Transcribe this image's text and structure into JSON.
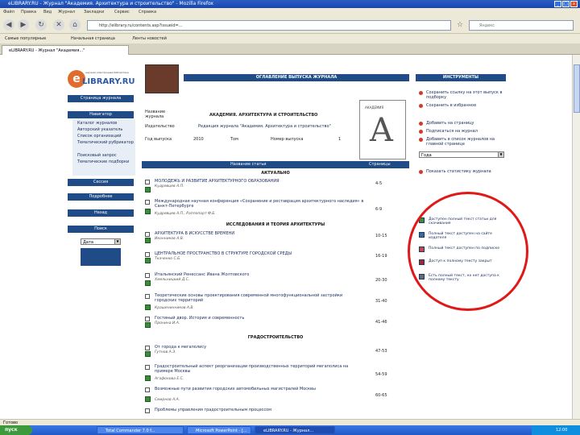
{
  "window": {
    "title": "eLIBRARY.RU - Журнал \"Академия. Архитектура и строительство\" - Mozilla Firefox",
    "controls": [
      "_",
      "□",
      "x"
    ]
  },
  "menu": [
    "Файл",
    "Правка",
    "Вид",
    "Журнал",
    "Закладки",
    "Сервис",
    "Справка"
  ],
  "nav": {
    "url": "http://elibrary.ru/contents.asp?issueid=...",
    "search_placeholder": "Яндекс"
  },
  "bookmarks": [
    "Самые популярные",
    "Начальная страница",
    "Ленты новостей"
  ],
  "tab": {
    "label": "eLIBRARY.RU - Журнал \"Академия...\""
  },
  "logo": {
    "letter": "e",
    "text": "LIBRARY.RU",
    "sub": "научная электронная библиотека"
  },
  "page_title": "ОГЛАВЛЕНИЕ ВЫПУСКА ЖУРНАЛА",
  "journal": {
    "name_label": "Название журнала",
    "name_value": "АКАДЕМИЯ. АРХИТЕКТУРА И СТРОИТЕЛЬСТВО",
    "publisher_label": "Издательство",
    "publisher_value": "Редакция журнала \"Академия. Архитектура и строительство\"",
    "year_label": "Год выпуска",
    "year_value": "2010",
    "tom_label": "Том",
    "issue_label": "Номер выпуска",
    "issue_value": "1",
    "cover_label": "АКАДЕМИЯ",
    "cover_letter": "A"
  },
  "leftnav": {
    "navigation_header": "Навигатор",
    "items": [
      "Навигатор",
      "Каталог журналов",
      "Авторский указатель",
      "Список организаций",
      "Тематический рубрикатор",
      "Поисковый запрос",
      "Тематические подборки"
    ],
    "btn_journal_pages": "Страница журнала",
    "btn_session": "Сессия",
    "btn_more": "Подробнее",
    "btn_back": "Назад",
    "search_label": "Поиск",
    "date_label": "Дата"
  },
  "toc": {
    "col_title": "Название статьи",
    "col_pages": "Страницы",
    "sections": [
      {
        "title": "АКТУАЛЬНО",
        "articles": [
          {
            "title": "МОЛОДЕЖЬ И РАЗВИТИЕ АРХИТЕКТУРНОГО ОБРАЗОВАНИЯ",
            "author": "Кудрявцев А.П.",
            "pages": "4-5"
          },
          {
            "title": "Международная научная конференция «Сохранение и реставрация архитектурного наследия» в Санкт-Петербурге",
            "author": "Кудрявцев А.П., Раппопорт Ф.Б.",
            "pages": "6-9"
          }
        ]
      },
      {
        "title": "ИССЛЕДОВАНИЯ И ТЕОРИЯ АРХИТЕКТУРЫ",
        "articles": [
          {
            "title": "АРХИТЕКТУРА В ИСКУССТВЕ ВРЕМЕНИ",
            "author": "Иконников А.В.",
            "pages": "10-15"
          },
          {
            "title": "ЦЕНТРАЛЬНОЕ ПРОСТРАНСТВО В СТРУКТУРЕ ГОРОДСКОЙ СРЕДЫ",
            "author": "Ткаченко С.Б.",
            "pages": "16-19"
          },
          {
            "title": "Итальянский Ренессанс Ивана Жолтовского",
            "author": "Хмельницкий Д.С.",
            "pages": "20-30"
          },
          {
            "title": "Теоретические основы проектирования современной многофункциональной застройки городских территорий",
            "author": "Крашенинников А.В.",
            "pages": "31-40"
          },
          {
            "title": "Гостиный двор. История и современность",
            "author": "Пронина И.А.",
            "pages": "41-46"
          }
        ]
      },
      {
        "title": "ГРАДОСТРОИТЕЛЬСТВО",
        "articles": [
          {
            "title": "От города к мегаполису",
            "author": "Гутнов А.Э.",
            "pages": "47-53"
          },
          {
            "title": "Градостроительный аспект реорганизации производственных территорий мегаполиса на примере Москвы",
            "author": "Агафонова Е.С.",
            "pages": "54-59"
          },
          {
            "title": "Возможные пути развития городских автомобильных магистралей Москвы",
            "author": "Смирнов А.А.",
            "pages": "60-65"
          },
          {
            "title": "Проблемы управления градостроительным процессом",
            "author": "",
            "pages": ""
          }
        ]
      }
    ]
  },
  "right": {
    "header_tools": "ИНСТРУМЕНТЫ",
    "tools": [
      "Сохранить ссылку на этот выпуск в подборку",
      "Сохранить в избранное",
      "Добавить на страницу",
      "Подписаться на журнал",
      "Добавить в список журналов на главной странице"
    ],
    "select_value": "Года",
    "tool_more": "Показать статистику журнала",
    "legend": [
      "Доступен полный текст статьи для скачивания",
      "Полный текст доступен на сайте издателя",
      "Полный текст доступен по подписке",
      "Доступ к полному тексту закрыт",
      "Есть полный текст, но нет доступа к полному тексту"
    ]
  },
  "status": "Готово",
  "taskbar": {
    "start": "пуск",
    "tasks": [
      "Total Commander 7.0 f...",
      "Microsoft PowerPoint - [...",
      "eLIBRARY.RU - Журнал..."
    ],
    "clock": "12:00"
  }
}
